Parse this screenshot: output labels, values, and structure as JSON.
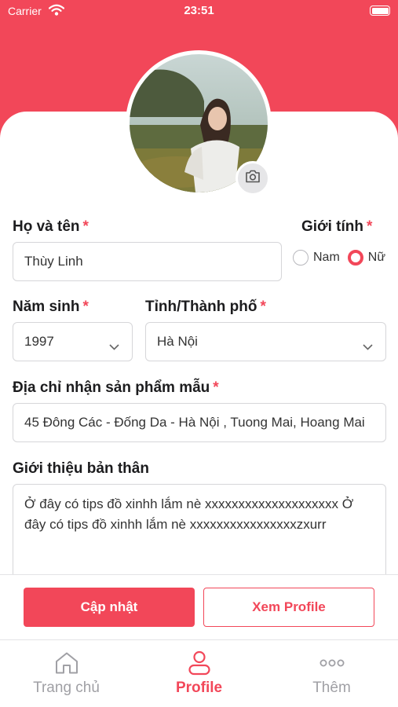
{
  "status_bar": {
    "carrier": "Carrier",
    "time": "23:51"
  },
  "profile": {
    "full_name": {
      "label": "Họ và tên",
      "required": "*",
      "value": "Thùy Linh"
    },
    "gender": {
      "label": "Giới tính",
      "required": "*",
      "options": [
        "Nam",
        "Nữ"
      ],
      "selected": "Nữ"
    },
    "birth_year": {
      "label": "Năm sinh",
      "required": "*",
      "value": "1997"
    },
    "province": {
      "label": "Tỉnh/Thành phố",
      "required": "*",
      "value": "Hà Nội"
    },
    "sample_address": {
      "label": "Địa chỉ nhận sản phẩm mẫu",
      "required": "*",
      "value": "45 Đông Các - Đống Da - Hà Nội , Tuong Mai, Hoang Mai"
    },
    "bio": {
      "label": "Giới thiệu bản thân",
      "value": "Ở đây có tips đồ xinhh lắm nè xxxxxxxxxxxxxxxxxxxx Ở đây có tips đồ xinhh lắm nè xxxxxxxxxxxxxxxxzxurr"
    }
  },
  "actions": {
    "update_label": "Cập nhật",
    "view_profile_label": "Xem Profile"
  },
  "tabs": [
    {
      "label": "Trang chủ",
      "icon": "home-icon",
      "active": false
    },
    {
      "label": "Profile",
      "icon": "user-icon",
      "active": true
    },
    {
      "label": "Thêm",
      "icon": "more-icon",
      "active": false
    }
  ],
  "colors": {
    "accent": "#f24759",
    "border": "#d6d6d9",
    "inactive": "#a0a0a5"
  }
}
